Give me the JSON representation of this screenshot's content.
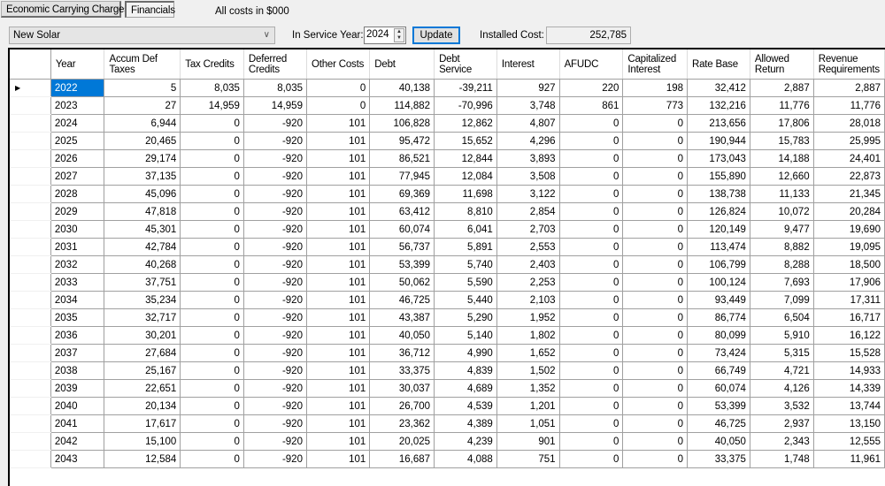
{
  "tabs": [
    {
      "label": "Economic Carrying Charges",
      "active": false
    },
    {
      "label": "Financials",
      "active": true
    }
  ],
  "note": "All costs in $000",
  "controls": {
    "resource_selected": "New Solar",
    "in_service_year_label": "In Service Year:",
    "in_service_year": "2024",
    "update_label": "Update",
    "installed_cost_label": "Installed Cost:",
    "installed_cost": "252,785"
  },
  "grid": {
    "columns": [
      "Year",
      "Accum Def Taxes",
      "Tax Credits",
      "Deferred Credits",
      "Other Costs",
      "Debt",
      "Debt Service",
      "Interest",
      "AFUDC",
      "Capitalized Interest",
      "Rate Base",
      "Allowed Return",
      "Revenue Requirements"
    ],
    "current_row_marker": "▶",
    "rows": [
      [
        "2022",
        "5",
        "8,035",
        "8,035",
        "0",
        "40,138",
        "-39,211",
        "927",
        "220",
        "198",
        "32,412",
        "2,887",
        "2,887"
      ],
      [
        "2023",
        "27",
        "14,959",
        "14,959",
        "0",
        "114,882",
        "-70,996",
        "3,748",
        "861",
        "773",
        "132,216",
        "11,776",
        "11,776"
      ],
      [
        "2024",
        "6,944",
        "0",
        "-920",
        "101",
        "106,828",
        "12,862",
        "4,807",
        "0",
        "0",
        "213,656",
        "17,806",
        "28,018"
      ],
      [
        "2025",
        "20,465",
        "0",
        "-920",
        "101",
        "95,472",
        "15,652",
        "4,296",
        "0",
        "0",
        "190,944",
        "15,783",
        "25,995"
      ],
      [
        "2026",
        "29,174",
        "0",
        "-920",
        "101",
        "86,521",
        "12,844",
        "3,893",
        "0",
        "0",
        "173,043",
        "14,188",
        "24,401"
      ],
      [
        "2027",
        "37,135",
        "0",
        "-920",
        "101",
        "77,945",
        "12,084",
        "3,508",
        "0",
        "0",
        "155,890",
        "12,660",
        "22,873"
      ],
      [
        "2028",
        "45,096",
        "0",
        "-920",
        "101",
        "69,369",
        "11,698",
        "3,122",
        "0",
        "0",
        "138,738",
        "11,133",
        "21,345"
      ],
      [
        "2029",
        "47,818",
        "0",
        "-920",
        "101",
        "63,412",
        "8,810",
        "2,854",
        "0",
        "0",
        "126,824",
        "10,072",
        "20,284"
      ],
      [
        "2030",
        "45,301",
        "0",
        "-920",
        "101",
        "60,074",
        "6,041",
        "2,703",
        "0",
        "0",
        "120,149",
        "9,477",
        "19,690"
      ],
      [
        "2031",
        "42,784",
        "0",
        "-920",
        "101",
        "56,737",
        "5,891",
        "2,553",
        "0",
        "0",
        "113,474",
        "8,882",
        "19,095"
      ],
      [
        "2032",
        "40,268",
        "0",
        "-920",
        "101",
        "53,399",
        "5,740",
        "2,403",
        "0",
        "0",
        "106,799",
        "8,288",
        "18,500"
      ],
      [
        "2033",
        "37,751",
        "0",
        "-920",
        "101",
        "50,062",
        "5,590",
        "2,253",
        "0",
        "0",
        "100,124",
        "7,693",
        "17,906"
      ],
      [
        "2034",
        "35,234",
        "0",
        "-920",
        "101",
        "46,725",
        "5,440",
        "2,103",
        "0",
        "0",
        "93,449",
        "7,099",
        "17,311"
      ],
      [
        "2035",
        "32,717",
        "0",
        "-920",
        "101",
        "43,387",
        "5,290",
        "1,952",
        "0",
        "0",
        "86,774",
        "6,504",
        "16,717"
      ],
      [
        "2036",
        "30,201",
        "0",
        "-920",
        "101",
        "40,050",
        "5,140",
        "1,802",
        "0",
        "0",
        "80,099",
        "5,910",
        "16,122"
      ],
      [
        "2037",
        "27,684",
        "0",
        "-920",
        "101",
        "36,712",
        "4,990",
        "1,652",
        "0",
        "0",
        "73,424",
        "5,315",
        "15,528"
      ],
      [
        "2038",
        "25,167",
        "0",
        "-920",
        "101",
        "33,375",
        "4,839",
        "1,502",
        "0",
        "0",
        "66,749",
        "4,721",
        "14,933"
      ],
      [
        "2039",
        "22,651",
        "0",
        "-920",
        "101",
        "30,037",
        "4,689",
        "1,352",
        "0",
        "0",
        "60,074",
        "4,126",
        "14,339"
      ],
      [
        "2040",
        "20,134",
        "0",
        "-920",
        "101",
        "26,700",
        "4,539",
        "1,201",
        "0",
        "0",
        "53,399",
        "3,532",
        "13,744"
      ],
      [
        "2041",
        "17,617",
        "0",
        "-920",
        "101",
        "23,362",
        "4,389",
        "1,051",
        "0",
        "0",
        "46,725",
        "2,937",
        "13,150"
      ],
      [
        "2042",
        "15,100",
        "0",
        "-920",
        "101",
        "20,025",
        "4,239",
        "901",
        "0",
        "0",
        "40,050",
        "2,343",
        "12,555"
      ],
      [
        "2043",
        "12,584",
        "0",
        "-920",
        "101",
        "16,687",
        "4,088",
        "751",
        "0",
        "0",
        "33,375",
        "1,748",
        "11,961"
      ]
    ]
  }
}
